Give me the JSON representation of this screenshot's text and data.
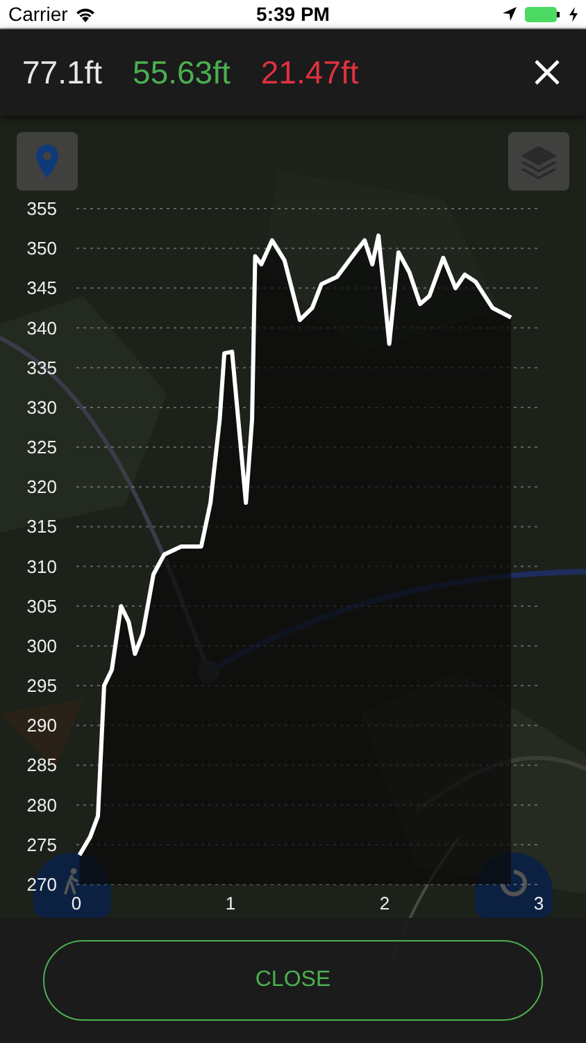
{
  "status_bar": {
    "carrier": "Carrier",
    "time": "5:39 PM"
  },
  "stats": [
    {
      "value": "77.1ft",
      "color": "#e8e8e8"
    },
    {
      "value": "55.63ft",
      "color": "#4caf50"
    },
    {
      "value": "21.47ft",
      "color": "#e0313f"
    }
  ],
  "chart_data": {
    "type": "area",
    "xlim": [
      0,
      3
    ],
    "ylim": [
      270,
      355
    ],
    "xticks": [
      0,
      1,
      2,
      3
    ],
    "yticks": [
      270,
      275,
      280,
      285,
      290,
      295,
      300,
      305,
      310,
      315,
      320,
      325,
      330,
      335,
      340,
      345,
      350,
      355
    ],
    "x": [
      0.02,
      0.09,
      0.14,
      0.18,
      0.23,
      0.29,
      0.34,
      0.38,
      0.43,
      0.5,
      0.57,
      0.68,
      0.81,
      0.87,
      0.93,
      0.96,
      1.01,
      1.05,
      1.1,
      1.14,
      1.16,
      1.2,
      1.27,
      1.35,
      1.45,
      1.53,
      1.59,
      1.69,
      1.81,
      1.87,
      1.92,
      1.96,
      2.03,
      2.09,
      2.16,
      2.23,
      2.29,
      2.38,
      2.46,
      2.52,
      2.59,
      2.7,
      2.82
    ],
    "grid": true,
    "series": [
      {
        "color": "#ffffff",
        "values": [
          273.7,
          276,
          278.6,
          295,
          297,
          305,
          303,
          299,
          301.5,
          309,
          311.5,
          312.5,
          312.5,
          318,
          328.5,
          336.8,
          337,
          328.5,
          318,
          328.5,
          349,
          348,
          351,
          348.5,
          341,
          342.5,
          345.5,
          346.4,
          349.5,
          351,
          348,
          351.6,
          338,
          349.5,
          347,
          343,
          344,
          348.8,
          345,
          346.7,
          345.8,
          342.5,
          341.3
        ]
      }
    ]
  },
  "close_button": {
    "label": "CLOSE"
  }
}
